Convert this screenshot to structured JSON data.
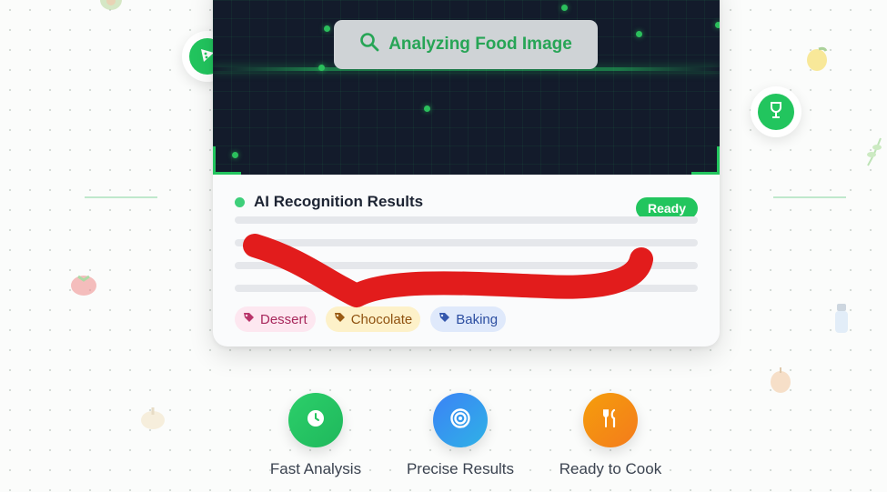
{
  "scanner": {
    "status_text": "Analyzing Food Image"
  },
  "results": {
    "title": "AI Recognition Results",
    "status_badge": "Ready",
    "tags": [
      {
        "label": "Dessert",
        "color": "#fde7f0"
      },
      {
        "label": "Chocolate",
        "color": "#fdf1c9"
      },
      {
        "label": "Baking",
        "color": "#dfe9fb"
      }
    ]
  },
  "floating_badges": {
    "left": "pizza-icon",
    "right": "wine-glass-icon"
  },
  "features": [
    {
      "label": "Fast Analysis",
      "icon": "clock-icon",
      "color": "#22c55e"
    },
    {
      "label": "Precise Results",
      "icon": "target-icon",
      "color": "#3b82f6"
    },
    {
      "label": "Ready to Cook",
      "icon": "utensils-icon",
      "color": "#f59e0b"
    }
  ],
  "annotation": {
    "scribble_color": "#e21c1c"
  }
}
